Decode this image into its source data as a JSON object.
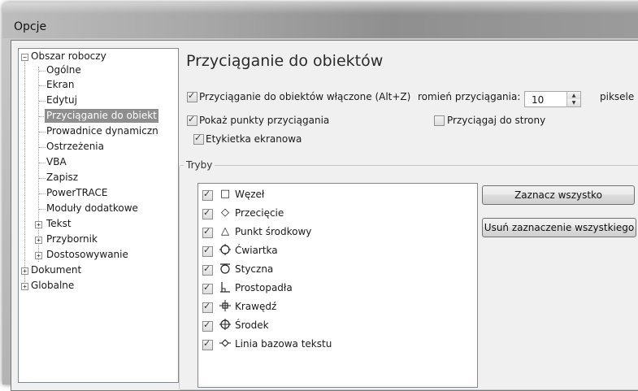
{
  "window": {
    "title": "Opcje"
  },
  "tree": {
    "root": "Obszar roboczy",
    "children": [
      "Ogólne",
      "Ekran",
      "Edytuj",
      "Przyciąganie do obiektów",
      "Prowadnice dynamiczne",
      "Ostrzeżenia",
      "VBA",
      "Zapisz",
      "PowerTRACE",
      "Moduły dodatkowe",
      "Tekst",
      "Przybornik",
      "Dostosowywanie"
    ],
    "top_level": [
      "Dokument",
      "Globalne"
    ],
    "selected": "Przyciąganie do obiektów",
    "selected_display": "Przyciąganie do obiekt",
    "prowadnice_display": "Prowadnice dynamiczn"
  },
  "panel": {
    "heading": "Przyciąganie do obiektów",
    "snap_enabled_label": "Przyciąganie do obiektów włączone (Alt+Z)",
    "snap_enabled_checked": true,
    "radius_label": "romień przyciągania:",
    "radius_value": "10",
    "radius_unit": "piksele",
    "show_points_label": "Pokaż punkty przyciągania",
    "show_points_checked": true,
    "snap_to_page_label": "Przyciągaj do strony",
    "snap_to_page_checked": false,
    "screen_tip_label": "Etykietka ekranowa",
    "screen_tip_checked": true,
    "modes_group_label": "Tryby",
    "modes": [
      {
        "label": "Węzeł",
        "icon": "square-icon",
        "checked": true
      },
      {
        "label": "Przecięcie",
        "icon": "diamond-icon",
        "checked": true
      },
      {
        "label": "Punkt środkowy",
        "icon": "triangle-icon",
        "checked": true
      },
      {
        "label": "Ćwiartka",
        "icon": "quadrant-icon",
        "checked": true
      },
      {
        "label": "Styczna",
        "icon": "tangent-icon",
        "checked": true
      },
      {
        "label": "Prostopadła",
        "icon": "perpendicular-icon",
        "checked": true
      },
      {
        "label": "Krawędź",
        "icon": "edge-icon",
        "checked": true
      },
      {
        "label": "Środek",
        "icon": "center-icon",
        "checked": true
      },
      {
        "label": "Linia bazowa tekstu",
        "icon": "baseline-icon",
        "checked": true
      }
    ],
    "select_all_button": "Zaznacz wszystko",
    "deselect_all_button": "Usuń zaznaczenie wszystkiego"
  }
}
